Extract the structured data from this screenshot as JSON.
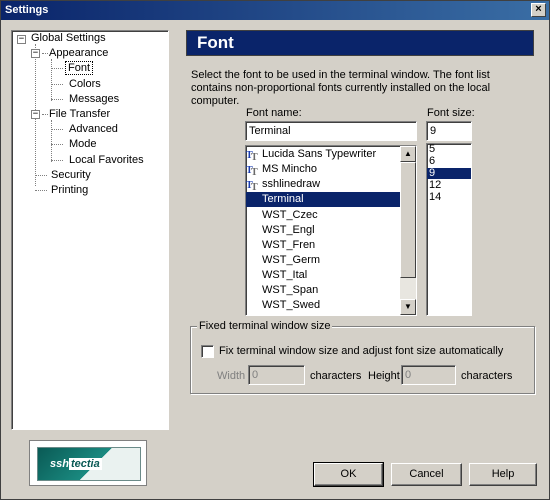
{
  "window": {
    "title": "Settings",
    "close_glyph": "×"
  },
  "tree": {
    "items": [
      {
        "label": "Global Settings",
        "name": "tree-item-global-settings"
      },
      {
        "label": "Appearance",
        "name": "tree-item-appearance"
      },
      {
        "label": "Font",
        "name": "tree-item-font",
        "selected": true
      },
      {
        "label": "Colors",
        "name": "tree-item-colors"
      },
      {
        "label": "Messages",
        "name": "tree-item-messages"
      },
      {
        "label": "File Transfer",
        "name": "tree-item-file-transfer"
      },
      {
        "label": "Advanced",
        "name": "tree-item-advanced"
      },
      {
        "label": "Mode",
        "name": "tree-item-mode"
      },
      {
        "label": "Local Favorites",
        "name": "tree-item-local-favorites"
      },
      {
        "label": "Security",
        "name": "tree-item-security"
      },
      {
        "label": "Printing",
        "name": "tree-item-printing"
      }
    ],
    "expander_glyph": "−"
  },
  "logo": {
    "part1": "ssh",
    "part2": "tectia"
  },
  "header": {
    "title": "Font"
  },
  "description": "Select the font to be used in the terminal window. The font list contains non-proportional fonts currently installed on the local computer.",
  "font_name": {
    "label": "Font name:",
    "value": "Terminal",
    "options": [
      {
        "label": "Lucida Sans Typewriter",
        "truetype": true
      },
      {
        "label": "MS Mincho",
        "truetype": true
      },
      {
        "label": "sshlinedraw",
        "truetype": true
      },
      {
        "label": "Terminal",
        "truetype": false,
        "selected": true
      },
      {
        "label": "WST_Czec",
        "truetype": false
      },
      {
        "label": "WST_Engl",
        "truetype": false
      },
      {
        "label": "WST_Fren",
        "truetype": false
      },
      {
        "label": "WST_Germ",
        "truetype": false
      },
      {
        "label": "WST_Ital",
        "truetype": false
      },
      {
        "label": "WST_Span",
        "truetype": false
      },
      {
        "label": "WST_Swed",
        "truetype": false
      }
    ],
    "truetype_icon": "truetype-font-icon"
  },
  "font_size": {
    "label": "Font size:",
    "value": "9",
    "options": [
      "5",
      "6",
      "9",
      "12",
      "14"
    ],
    "selected": "9"
  },
  "fixed_size": {
    "group_title": "Fixed terminal window size",
    "checkbox_label": "Fix terminal window size and adjust font size automatically",
    "checked": false,
    "width_label": "Width",
    "width_value": "0",
    "width_unit": "characters",
    "height_label": "Height",
    "height_value": "0",
    "height_unit": "characters"
  },
  "buttons": {
    "ok": "OK",
    "cancel": "Cancel",
    "help": "Help"
  },
  "colors": {
    "title_bar": "#0a246a",
    "selection": "#0a246a",
    "face": "#d4d0c8"
  }
}
